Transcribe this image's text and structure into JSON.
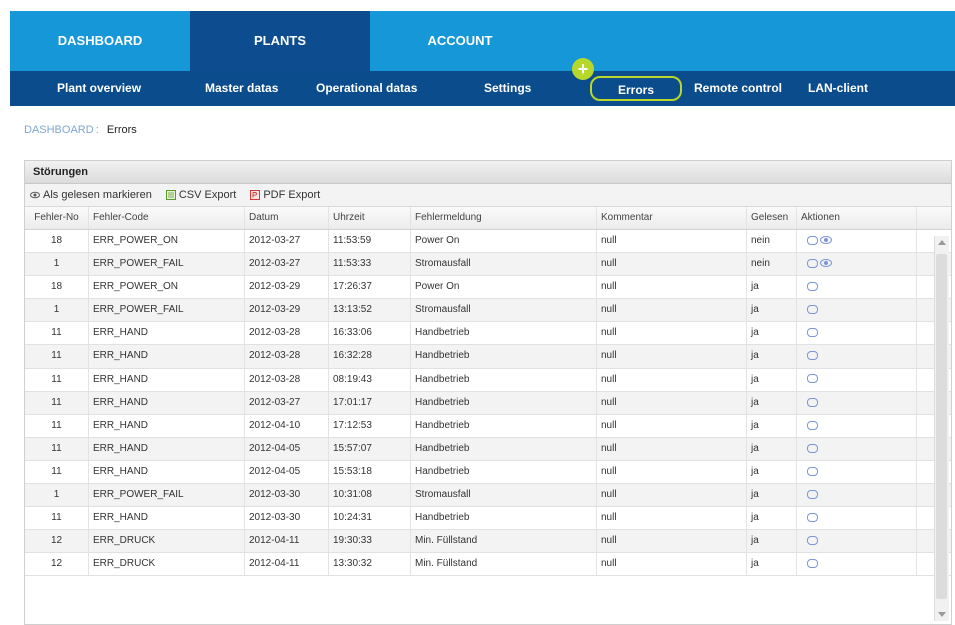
{
  "nav": {
    "tabs": [
      {
        "label": "DASHBOARD"
      },
      {
        "label": "PLANTS"
      },
      {
        "label": "ACCOUNT"
      }
    ],
    "subnav": [
      {
        "label": "Plant overview"
      },
      {
        "label": "Master datas"
      },
      {
        "label": "Operational datas"
      },
      {
        "label": "Settings"
      },
      {
        "label": "Errors"
      },
      {
        "label": "Remote control"
      },
      {
        "label": "LAN-client"
      }
    ],
    "badge": "+"
  },
  "breadcrumb": {
    "root": "DASHBOARD",
    "separator": ":",
    "current": "Errors"
  },
  "panel": {
    "title": "Störungen",
    "toolbar": {
      "mark_read": "Als gelesen markieren",
      "csv_export": "CSV Export",
      "pdf_export": "PDF Export"
    }
  },
  "table": {
    "columns": [
      "Fehler-No",
      "Fehler-Code",
      "Datum",
      "Uhrzeit",
      "Fehlermeldung",
      "Kommentar",
      "Gelesen",
      "Aktionen"
    ],
    "rows": [
      {
        "no": "18",
        "code": "ERR_POWER_ON",
        "datum": "2012-03-27",
        "uhrzeit": "11:53:59",
        "meldung": "Power On",
        "kommentar": "null",
        "gelesen": "nein",
        "eye": true
      },
      {
        "no": "1",
        "code": "ERR_POWER_FAIL",
        "datum": "2012-03-27",
        "uhrzeit": "11:53:33",
        "meldung": "Stromausfall",
        "kommentar": "null",
        "gelesen": "nein",
        "eye": true
      },
      {
        "no": "18",
        "code": "ERR_POWER_ON",
        "datum": "2012-03-29",
        "uhrzeit": "17:26:37",
        "meldung": "Power On",
        "kommentar": "null",
        "gelesen": "ja",
        "eye": false
      },
      {
        "no": "1",
        "code": "ERR_POWER_FAIL",
        "datum": "2012-03-29",
        "uhrzeit": "13:13:52",
        "meldung": "Stromausfall",
        "kommentar": "null",
        "gelesen": "ja",
        "eye": false
      },
      {
        "no": "11",
        "code": "ERR_HAND",
        "datum": "2012-03-28",
        "uhrzeit": "16:33:06",
        "meldung": "Handbetrieb",
        "kommentar": "null",
        "gelesen": "ja",
        "eye": false
      },
      {
        "no": "11",
        "code": "ERR_HAND",
        "datum": "2012-03-28",
        "uhrzeit": "16:32:28",
        "meldung": "Handbetrieb",
        "kommentar": "null",
        "gelesen": "ja",
        "eye": false
      },
      {
        "no": "11",
        "code": "ERR_HAND",
        "datum": "2012-03-28",
        "uhrzeit": "08:19:43",
        "meldung": "Handbetrieb",
        "kommentar": "null",
        "gelesen": "ja",
        "eye": false
      },
      {
        "no": "11",
        "code": "ERR_HAND",
        "datum": "2012-03-27",
        "uhrzeit": "17:01:17",
        "meldung": "Handbetrieb",
        "kommentar": "null",
        "gelesen": "ja",
        "eye": false
      },
      {
        "no": "11",
        "code": "ERR_HAND",
        "datum": "2012-04-10",
        "uhrzeit": "17:12:53",
        "meldung": "Handbetrieb",
        "kommentar": "null",
        "gelesen": "ja",
        "eye": false
      },
      {
        "no": "11",
        "code": "ERR_HAND",
        "datum": "2012-04-05",
        "uhrzeit": "15:57:07",
        "meldung": "Handbetrieb",
        "kommentar": "null",
        "gelesen": "ja",
        "eye": false
      },
      {
        "no": "11",
        "code": "ERR_HAND",
        "datum": "2012-04-05",
        "uhrzeit": "15:53:18",
        "meldung": "Handbetrieb",
        "kommentar": "null",
        "gelesen": "ja",
        "eye": false
      },
      {
        "no": "1",
        "code": "ERR_POWER_FAIL",
        "datum": "2012-03-30",
        "uhrzeit": "10:31:08",
        "meldung": "Stromausfall",
        "kommentar": "null",
        "gelesen": "ja",
        "eye": false
      },
      {
        "no": "11",
        "code": "ERR_HAND",
        "datum": "2012-03-30",
        "uhrzeit": "10:24:31",
        "meldung": "Handbetrieb",
        "kommentar": "null",
        "gelesen": "ja",
        "eye": false
      },
      {
        "no": "12",
        "code": "ERR_DRUCK",
        "datum": "2012-04-11",
        "uhrzeit": "19:30:33",
        "meldung": "Min. Füllstand",
        "kommentar": "null",
        "gelesen": "ja",
        "eye": false
      },
      {
        "no": "12",
        "code": "ERR_DRUCK",
        "datum": "2012-04-11",
        "uhrzeit": "13:30:32",
        "meldung": "Min. Füllstand",
        "kommentar": "null",
        "gelesen": "ja",
        "eye": false
      }
    ]
  },
  "icons": {
    "eye": "eye-icon",
    "csv": "csv-icon",
    "pdf": "pdf-icon",
    "comment": "comment-icon"
  },
  "colors": {
    "top_nav": "#1597d8",
    "active_tab": "#0d4d8f",
    "sub_nav": "#0b4c8c",
    "highlight": "#b7d82b"
  }
}
